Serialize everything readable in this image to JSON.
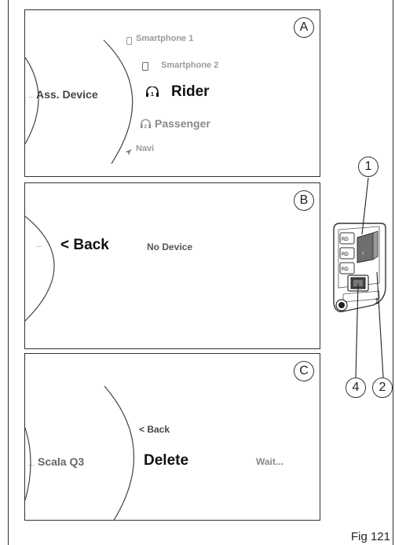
{
  "panels": {
    "a": {
      "label": "A",
      "breadcrumb": "Ass. Device",
      "dots": "...",
      "items": [
        {
          "label": "Smartphone 1",
          "icon": "smartphone-icon"
        },
        {
          "label": "Smartphone 2",
          "icon": "smartphone-icon"
        },
        {
          "label": "Rider",
          "icon": "headset-1-icon"
        },
        {
          "label": "Passenger",
          "icon": "headset-2-icon"
        },
        {
          "label": "Navi",
          "icon": "navigation-arrow-icon"
        }
      ]
    },
    "b": {
      "label": "B",
      "dots": "...",
      "back": "< Back",
      "status": "No Device"
    },
    "c": {
      "label": "C",
      "dots": "...",
      "breadcrumb": "Scala Q3",
      "back": "< Back",
      "action": "Delete",
      "status": "Wait..."
    }
  },
  "callouts": [
    "1",
    "2",
    "4"
  ],
  "figure_caption": "Fig 121"
}
